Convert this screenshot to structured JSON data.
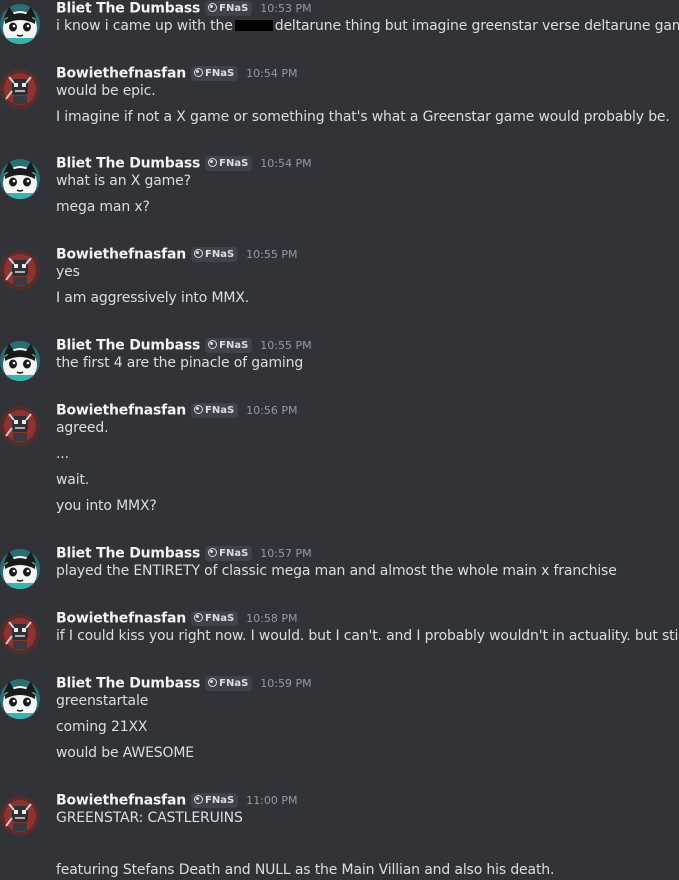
{
  "badge": {
    "tag": "FNaS"
  },
  "messages": [
    {
      "author": "Bliet The Dumbass",
      "avatar": "cat-avatar",
      "time": "10:53 PM",
      "lines": [
        {
          "before": "i know i came up with the",
          "redacted": true,
          "after": "deltarune thing but imagine greenstar verse deltarune game"
        }
      ]
    },
    {
      "author": "Bowiethefnasfan",
      "avatar": "robot-avatar",
      "time": "10:54 PM",
      "lines": [
        "would be epic.",
        "I imagine if not a X game or something that's what a Greenstar game would probably be."
      ]
    },
    {
      "author": "Bliet The Dumbass",
      "avatar": "cat-avatar",
      "time": "10:54 PM",
      "lines": [
        "what is an X game?",
        "mega man x?"
      ]
    },
    {
      "author": "Bowiethefnasfan",
      "avatar": "robot-avatar",
      "time": "10:55 PM",
      "lines": [
        "yes",
        "I am aggressively into MMX."
      ]
    },
    {
      "author": "Bliet The Dumbass",
      "avatar": "cat-avatar",
      "time": "10:55 PM",
      "lines": [
        "the first 4 are the pinacle of gaming"
      ]
    },
    {
      "author": "Bowiethefnasfan",
      "avatar": "robot-avatar",
      "time": "10:56 PM",
      "lines": [
        "agreed.",
        "...",
        "wait.",
        "you into MMX?"
      ]
    },
    {
      "author": "Bliet The Dumbass",
      "avatar": "cat-avatar",
      "time": "10:57 PM",
      "lines": [
        "played the ENTIRETY of classic mega man and almost the whole main x franchise"
      ]
    },
    {
      "author": "Bowiethefnasfan",
      "avatar": "robot-avatar",
      "time": "10:58 PM",
      "lines": [
        "if I could kiss you right now. I would. but I can't. and I probably wouldn't in actuality. but still."
      ]
    },
    {
      "author": "Bliet The Dumbass",
      "avatar": "cat-avatar",
      "time": "10:59 PM",
      "lines": [
        "greenstartale",
        "coming 21XX",
        "would be AWESOME"
      ]
    },
    {
      "author": "Bowiethefnasfan",
      "avatar": "robot-avatar",
      "time": "11:00 PM",
      "lines": [
        "GREENSTAR: CASTLERUINS",
        "",
        "featuring Stefans Death and NULL as the Main Villian and also his death."
      ]
    }
  ]
}
